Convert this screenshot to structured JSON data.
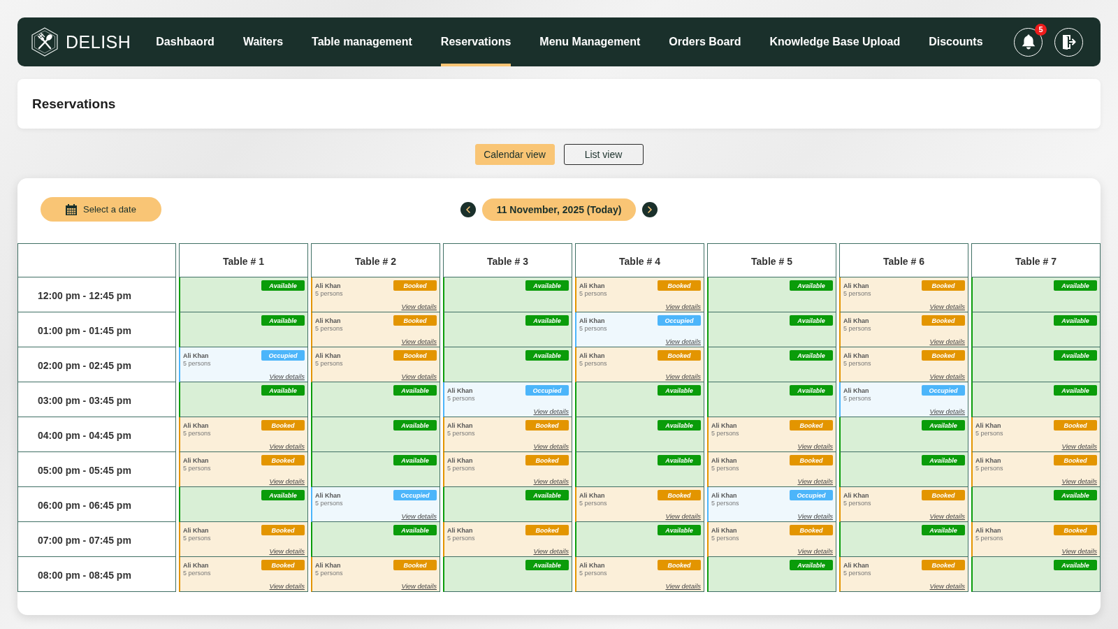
{
  "brand": {
    "name": "DELISH"
  },
  "nav": {
    "items": [
      {
        "label": "Dashbaord",
        "selected": false
      },
      {
        "label": "Waiters",
        "selected": false
      },
      {
        "label": "Table management",
        "selected": false
      },
      {
        "label": "Reservations",
        "selected": true
      },
      {
        "label": "Menu Management",
        "selected": false
      },
      {
        "label": "Orders Board",
        "selected": false
      },
      {
        "label": "Knowledge Base Upload",
        "selected": false
      },
      {
        "label": "Discounts",
        "selected": false
      }
    ],
    "notifications": {
      "count": "5"
    }
  },
  "page_header": {
    "title": "Reservations"
  },
  "view_toggle": [
    {
      "label": "Calendar view",
      "selected": true
    },
    {
      "label": "List view",
      "selected": false
    }
  ],
  "calendar": {
    "date_button": "Select a date",
    "current_date": "11 November, 2025 (Today)",
    "columns": [
      "Table # 1",
      "Table # 2",
      "Table # 3",
      "Table # 4",
      "Table # 5",
      "Table # 6",
      "Table # 7"
    ],
    "rows": [
      {
        "time": "12:00 pm - 12:45 pm",
        "cells": [
          {
            "kind": "available",
            "status": "Available"
          },
          {
            "kind": "booked",
            "status": "Booked",
            "guest": "Ali Khan",
            "party": "5 persons",
            "link": "View details"
          },
          {
            "kind": "available",
            "status": "Available"
          },
          {
            "kind": "booked",
            "status": "Booked",
            "guest": "Ali Khan",
            "party": "5 persons",
            "link": "View details"
          },
          {
            "kind": "available",
            "status": "Available"
          },
          {
            "kind": "booked",
            "status": "Booked",
            "guest": "Ali Khan",
            "party": "5 persons",
            "link": "View details"
          },
          {
            "kind": "available",
            "status": "Available"
          }
        ]
      },
      {
        "time": "01:00 pm - 01:45 pm",
        "cells": [
          {
            "kind": "available",
            "status": "Available"
          },
          {
            "kind": "booked",
            "status": "Booked",
            "guest": "Ali Khan",
            "party": "5 persons",
            "link": "View details"
          },
          {
            "kind": "available",
            "status": "Available"
          },
          {
            "kind": "occupied",
            "status": "Occupied",
            "guest": "Ali Khan",
            "party": "5 persons",
            "link": "View details"
          },
          {
            "kind": "available",
            "status": "Available"
          },
          {
            "kind": "booked",
            "status": "Booked",
            "guest": "Ali Khan",
            "party": "5 persons",
            "link": "View details"
          },
          {
            "kind": "available",
            "status": "Available"
          }
        ]
      },
      {
        "time": "02:00 pm - 02:45 pm",
        "cells": [
          {
            "kind": "occupied",
            "status": "Occupied",
            "guest": "Ali Khan",
            "party": "5 persons",
            "link": "View details"
          },
          {
            "kind": "booked",
            "status": "Booked",
            "guest": "Ali Khan",
            "party": "5 persons",
            "link": "View details"
          },
          {
            "kind": "available",
            "status": "Available"
          },
          {
            "kind": "booked",
            "status": "Booked",
            "guest": "Ali Khan",
            "party": "5 persons",
            "link": "View details"
          },
          {
            "kind": "available",
            "status": "Available"
          },
          {
            "kind": "booked",
            "status": "Booked",
            "guest": "Ali Khan",
            "party": "5 persons",
            "link": "View details"
          },
          {
            "kind": "available",
            "status": "Available"
          }
        ]
      },
      {
        "time": "03:00 pm - 03:45 pm",
        "cells": [
          {
            "kind": "available",
            "status": "Available"
          },
          {
            "kind": "available",
            "status": "Available"
          },
          {
            "kind": "occupied",
            "status": "Occupied",
            "guest": "Ali Khan",
            "party": "5 persons",
            "link": "View details"
          },
          {
            "kind": "available",
            "status": "Available"
          },
          {
            "kind": "available",
            "status": "Available"
          },
          {
            "kind": "occupied",
            "status": "Occupied",
            "guest": "Ali Khan",
            "party": "5 persons",
            "link": "View details"
          },
          {
            "kind": "available",
            "status": "Available"
          }
        ]
      },
      {
        "time": "04:00 pm - 04:45 pm",
        "cells": [
          {
            "kind": "booked",
            "status": "Booked",
            "guest": "Ali Khan",
            "party": "5 persons",
            "link": "View details"
          },
          {
            "kind": "available",
            "status": "Available"
          },
          {
            "kind": "booked",
            "status": "Booked",
            "guest": "Ali Khan",
            "party": "5 persons",
            "link": "View details"
          },
          {
            "kind": "available",
            "status": "Available"
          },
          {
            "kind": "booked",
            "status": "Booked",
            "guest": "Ali Khan",
            "party": "5 persons",
            "link": "View details"
          },
          {
            "kind": "available",
            "status": "Available"
          },
          {
            "kind": "booked",
            "status": "Booked",
            "guest": "Ali Khan",
            "party": "5 persons",
            "link": "View details"
          }
        ]
      },
      {
        "time": "05:00 pm - 05:45 pm",
        "cells": [
          {
            "kind": "booked",
            "status": "Booked",
            "guest": "Ali Khan",
            "party": "5 persons",
            "link": "View details"
          },
          {
            "kind": "available",
            "status": "Available"
          },
          {
            "kind": "booked",
            "status": "Booked",
            "guest": "Ali Khan",
            "party": "5 persons",
            "link": "View details"
          },
          {
            "kind": "available",
            "status": "Available"
          },
          {
            "kind": "booked",
            "status": "Booked",
            "guest": "Ali Khan",
            "party": "5 persons",
            "link": "View details"
          },
          {
            "kind": "available",
            "status": "Available"
          },
          {
            "kind": "booked",
            "status": "Booked",
            "guest": "Ali Khan",
            "party": "5 persons",
            "link": "View details"
          }
        ]
      },
      {
        "time": "06:00 pm - 06:45 pm",
        "cells": [
          {
            "kind": "available",
            "status": "Available"
          },
          {
            "kind": "occupied",
            "status": "Occupied",
            "guest": "Ali Khan",
            "party": "5 persons",
            "link": "View details"
          },
          {
            "kind": "available",
            "status": "Available"
          },
          {
            "kind": "booked",
            "status": "Booked",
            "guest": "Ali Khan",
            "party": "5 persons",
            "link": "View details"
          },
          {
            "kind": "occupied",
            "status": "Occupied",
            "guest": "Ali Khan",
            "party": "5 persons",
            "link": "View details"
          },
          {
            "kind": "booked",
            "status": "Booked",
            "guest": "Ali Khan",
            "party": "5 persons",
            "link": "View details"
          },
          {
            "kind": "available",
            "status": "Available"
          }
        ]
      },
      {
        "time": "07:00 pm - 07:45 pm",
        "cells": [
          {
            "kind": "booked",
            "status": "Booked",
            "guest": "Ali Khan",
            "party": "5 persons",
            "link": "View details"
          },
          {
            "kind": "available",
            "status": "Available"
          },
          {
            "kind": "booked",
            "status": "Booked",
            "guest": "Ali Khan",
            "party": "5 persons",
            "link": "View details"
          },
          {
            "kind": "available",
            "status": "Available"
          },
          {
            "kind": "booked",
            "status": "Booked",
            "guest": "Ali Khan",
            "party": "5 persons",
            "link": "View details"
          },
          {
            "kind": "available",
            "status": "Available"
          },
          {
            "kind": "booked",
            "status": "Booked",
            "guest": "Ali Khan",
            "party": "5 persons",
            "link": "View details"
          }
        ]
      },
      {
        "time": "08:00 pm - 08:45 pm",
        "cells": [
          {
            "kind": "booked",
            "status": "Booked",
            "guest": "Ali Khan",
            "party": "5 persons",
            "link": "View details"
          },
          {
            "kind": "booked",
            "status": "Booked",
            "guest": "Ali Khan",
            "party": "5 persons",
            "link": "View details"
          },
          {
            "kind": "available",
            "status": "Available"
          },
          {
            "kind": "booked",
            "status": "Booked",
            "guest": "Ali Khan",
            "party": "5 persons",
            "link": "View details"
          },
          {
            "kind": "available",
            "status": "Available"
          },
          {
            "kind": "booked",
            "status": "Booked",
            "guest": "Ali Khan",
            "party": "5 persons",
            "link": "View details"
          },
          {
            "kind": "available",
            "status": "Available"
          }
        ]
      }
    ]
  }
}
